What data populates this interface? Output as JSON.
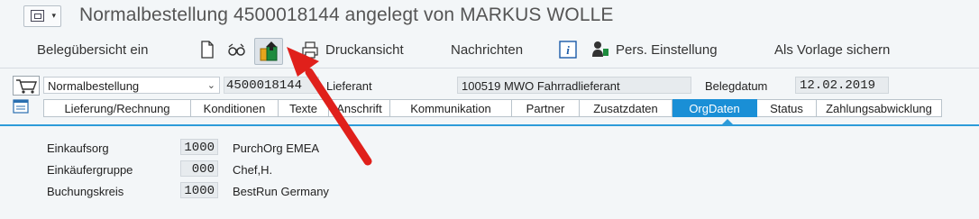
{
  "window": {
    "title": "Normalbestellung 4500018144 angelegt von MARKUS WOLLE"
  },
  "toolbar": {
    "belegubersicht": "Belegübersicht ein",
    "druckansicht": "Druckansicht",
    "nachrichten": "Nachrichten",
    "pers_einstellung": "Pers. Einstellung",
    "als_vorlage": "Als Vorlage sichern"
  },
  "header": {
    "order_type": "Normalbestellung",
    "po_number": "4500018144",
    "lieferant_label": "Lieferant",
    "lieferant_value": "100519 MWO Fahrradlieferant",
    "belegdatum_label": "Belegdatum",
    "belegdatum_value": "12.02.2019"
  },
  "tabs": [
    {
      "label": "Lieferung/Rechnung"
    },
    {
      "label": "Konditionen"
    },
    {
      "label": "Texte"
    },
    {
      "label": "Anschrift"
    },
    {
      "label": "Kommunikation"
    },
    {
      "label": "Partner"
    },
    {
      "label": "Zusatzdaten"
    },
    {
      "label": "OrgDaten",
      "active": true
    },
    {
      "label": "Status"
    },
    {
      "label": "Zahlungsabwicklung"
    }
  ],
  "org": [
    {
      "label": "Einkaufsorg",
      "code": "1000",
      "desc": "PurchOrg EMEA"
    },
    {
      "label": "Einkäufergruppe",
      "code": "000",
      "desc": "Chef,H."
    },
    {
      "label": "Buchungskreis",
      "code": "1000",
      "desc": "BestRun Germany"
    }
  ],
  "colors": {
    "accent": "#1a8fd6",
    "arrow": "#e0201b",
    "background": "#f3f6f8"
  },
  "icons": [
    "menu-icon",
    "document-icon",
    "glasses-icon",
    "export-icon",
    "printer-icon",
    "info-icon",
    "person-settings-icon",
    "cart-icon",
    "tab-list-icon"
  ]
}
